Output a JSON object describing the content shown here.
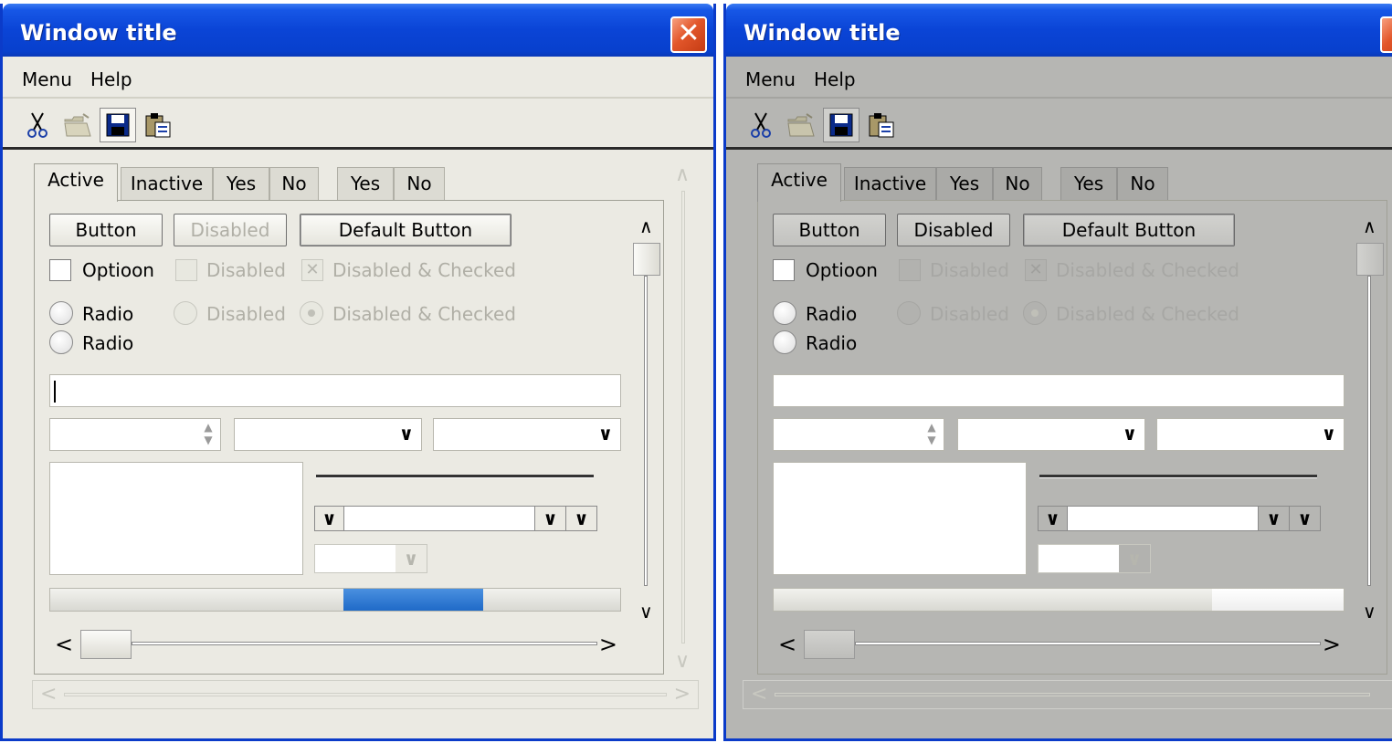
{
  "windows": [
    {
      "title": "Window title",
      "close_glyph": "✕",
      "menu": {
        "items": [
          "Menu",
          "Help"
        ]
      },
      "toolbar": {
        "icons": [
          "cut-icon",
          "open-folder-icon",
          "save-icon",
          "paste-icon"
        ]
      },
      "tabs": [
        "Active",
        "Inactive",
        "Yes",
        "No",
        "Yes",
        "No"
      ],
      "buttons": {
        "button": "Button",
        "disabled": "Disabled",
        "default": "Default Button"
      },
      "checkboxes": {
        "option": "Optioon",
        "disabled": "Disabled",
        "disabled_checked": "Disabled & Checked"
      },
      "radios": {
        "radio1": "Radio",
        "radio2": "Radio",
        "disabled": "Disabled",
        "disabled_checked": "Disabled & Checked"
      },
      "text_field": {
        "value": ""
      },
      "progress": {
        "start": 0.515,
        "end": 0.76
      },
      "slider": {
        "value": 0.0
      },
      "colors": {
        "titlebar": "#0a44d6",
        "client": "#ebeae3",
        "progress_fill": "#1f6ac8"
      }
    },
    {
      "title": "Window title",
      "close_glyph": "",
      "menu": {
        "items": [
          "Menu",
          "Help"
        ]
      },
      "toolbar": {
        "icons": [
          "cut-icon",
          "open-folder-icon",
          "save-icon",
          "paste-icon"
        ]
      },
      "tabs": [
        "Active",
        "Inactive",
        "Yes",
        "No",
        "Yes",
        "No"
      ],
      "buttons": {
        "button": "Button",
        "disabled": "Disabled",
        "default": "Default Button"
      },
      "checkboxes": {
        "option": "Optioon",
        "disabled": "Disabled",
        "disabled_checked": "Disabled & Checked"
      },
      "radios": {
        "radio1": "Radio",
        "radio2": "Radio",
        "disabled": "Disabled",
        "disabled_checked": "Disabled & Checked"
      },
      "text_field": {
        "value": ""
      },
      "progress": {
        "start": 0.77,
        "end": 1.0
      },
      "slider": {
        "value": 0.0
      },
      "colors": {
        "titlebar": "#0a44d6",
        "client": "#b6b6b3",
        "progress_fill": "#ffffff"
      }
    }
  ]
}
